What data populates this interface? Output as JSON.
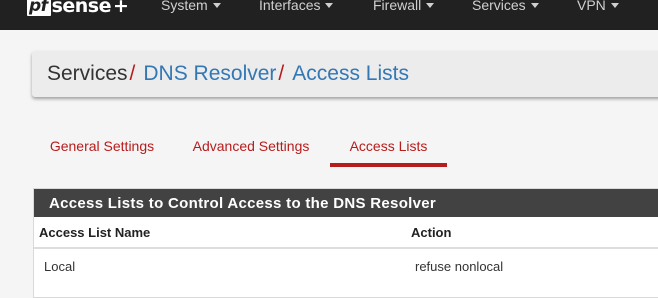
{
  "brand": {
    "pf": "pf",
    "rest": "sense",
    "plus": "+"
  },
  "navbar": {
    "items": [
      {
        "label": "System"
      },
      {
        "label": "Interfaces"
      },
      {
        "label": "Firewall"
      },
      {
        "label": "Services"
      },
      {
        "label": "VPN"
      }
    ]
  },
  "breadcrumb": {
    "root": "Services",
    "sep1": "/",
    "item1": "DNS Resolver",
    "sep2": "/",
    "item2": "Access Lists"
  },
  "tabs": [
    {
      "label": "General Settings",
      "active": false
    },
    {
      "label": "Advanced Settings",
      "active": false
    },
    {
      "label": "Access Lists",
      "active": true
    }
  ],
  "panel": {
    "title": "Access Lists to Control Access to the DNS Resolver",
    "columns": [
      "Access List Name",
      "Action"
    ],
    "rows": [
      {
        "name": "Local",
        "action": "refuse nonlocal"
      }
    ]
  },
  "colors": {
    "navbar_bg": "#212121",
    "accent_red": "#b71c1c",
    "link_blue": "#3377b5",
    "panel_heading_bg": "#424242"
  }
}
